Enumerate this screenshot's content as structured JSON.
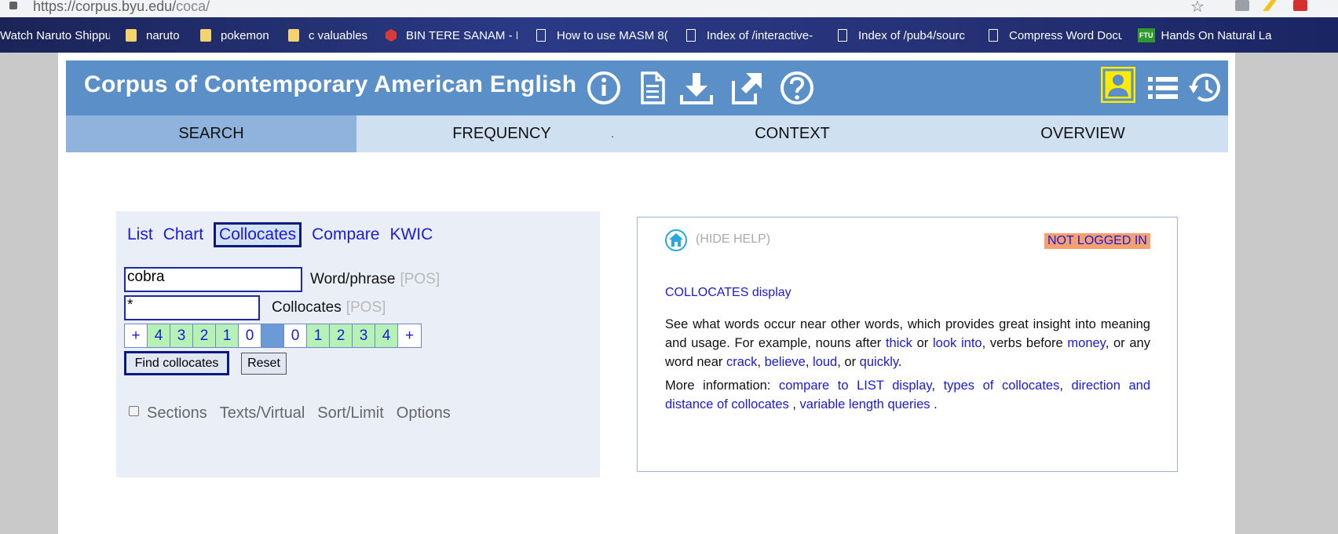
{
  "browser": {
    "url_host": "https://corpus.byu.edu/",
    "url_path": "coca/",
    "bookmarks": [
      {
        "label": "Watch Naruto Shippu",
        "icon": "none"
      },
      {
        "label": "naruto",
        "icon": "folder"
      },
      {
        "label": "pokemon",
        "icon": "folder"
      },
      {
        "label": "c valuables",
        "icon": "folder"
      },
      {
        "label": "BIN TERE SANAM - P",
        "icon": "red-hex"
      },
      {
        "label": "How to use MASM 8(",
        "icon": "page"
      },
      {
        "label": "Index of /interactive-",
        "icon": "page"
      },
      {
        "label": "Index of /pub4/sourc",
        "icon": "page"
      },
      {
        "label": "Compress Word Docu",
        "icon": "page"
      },
      {
        "label": "Hands On Natural La",
        "icon": "ftu",
        "badge": "FTU"
      }
    ]
  },
  "header": {
    "title": "Corpus of Contemporary American English",
    "icons": [
      "info-icon",
      "document-icon",
      "download-icon",
      "external-link-icon",
      "help-icon",
      "user-icon",
      "list-icon",
      "history-icon"
    ],
    "user_highlight": "#ffeb00"
  },
  "tabs": [
    {
      "label": "SEARCH",
      "active": true
    },
    {
      "label": "FREQUENCY",
      "active": false
    },
    {
      "label": "CONTEXT",
      "active": false
    },
    {
      "label": "OVERVIEW",
      "active": false
    }
  ],
  "tab_dot": ".",
  "search": {
    "modes": [
      "List",
      "Chart",
      "Collocates",
      "Compare",
      "KWIC"
    ],
    "active_mode": "Collocates",
    "word_value": "cobra",
    "word_label": "Word/phrase",
    "word_pos": "[POS]",
    "coll_value": "*",
    "coll_label": "Collocates",
    "coll_pos": "[POS]",
    "span_left": [
      "+",
      "4",
      "3",
      "2",
      "1",
      "0"
    ],
    "span_right": [
      "0",
      "1",
      "2",
      "3",
      "4",
      "+"
    ],
    "find_button": "Find collocates",
    "reset_button": "Reset",
    "options": [
      "Sections",
      "Texts/Virtual",
      "Sort/Limit",
      "Options"
    ]
  },
  "help": {
    "hide_help": "(HIDE HELP)",
    "status": "NOT LOGGED IN",
    "title": "COLLOCATES display",
    "p1": {
      "t1": "See what words occur near other words, which provides great insight into meaning and usage. For example, nouns after ",
      "l1": "thick",
      "t2": " or ",
      "l2": "look into",
      "t3": ", verbs before ",
      "l3": "money",
      "t4": ", or any word near ",
      "l4": "crack",
      "t5": ", ",
      "l5": "believe",
      "t6": ", ",
      "l6": "loud",
      "t7": ", or ",
      "l7": "quickly",
      "t8": "."
    },
    "p2": {
      "t1": "More information: ",
      "l1": "compare to LIST display",
      "t2": ", ",
      "l2": "types of collocates",
      "t3": ", ",
      "l3": "direction and distance of collocates",
      "t4": " , ",
      "l4": "variable length queries",
      "t5": " ."
    }
  },
  "colors": {
    "header_bg": "#5b8fc8",
    "tab_active": "#8fb3dc",
    "tab_bg": "#cfe0f1",
    "link": "#1a1ad8",
    "span_green": "#b6f1b6",
    "status_bg": "#f4a070"
  }
}
